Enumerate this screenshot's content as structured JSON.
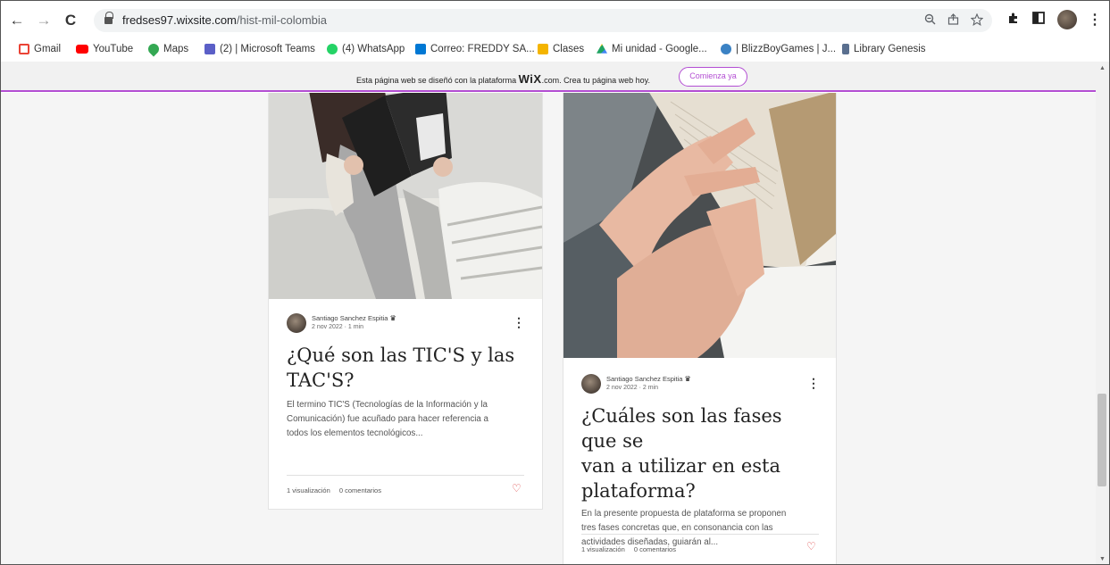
{
  "browser": {
    "nav": {
      "back": "←",
      "forward": "→",
      "reload": "C"
    },
    "url_domain": "fredses97.wixsite.com",
    "url_path": "/hist-mil-colombia",
    "icons": [
      "zoom-icon",
      "share-icon",
      "star-icon",
      "extensions-icon",
      "side-panel-icon",
      "menu-icon"
    ]
  },
  "bookmarks": [
    {
      "label": "Gmail",
      "color": "#ea4335"
    },
    {
      "label": "YouTube",
      "color": "#ff0000"
    },
    {
      "label": "Maps",
      "color": "#34a853"
    },
    {
      "label": "(2) | Microsoft Teams",
      "color": "#5b5fc7"
    },
    {
      "label": "(4) WhatsApp",
      "color": "#25d366"
    },
    {
      "label": "Correo: FREDDY SA...",
      "color": "#0078d4"
    },
    {
      "label": "Clases",
      "color": "#f4b400"
    },
    {
      "label": "Mi unidad - Google...",
      "color": "#1fa463"
    },
    {
      "label": "| BlizzBoyGames | J...",
      "color": "#3b82c4"
    },
    {
      "label": "Library Genesis",
      "color": "#5a6f8f"
    }
  ],
  "wix_banner": {
    "text_before": "Esta página web se diseñó con la plataforma",
    "logo": "WiX",
    "text_after": ".com. Crea tu página web hoy.",
    "button": "Comienza ya"
  },
  "posts": [
    {
      "author": "Santiago Sanchez Espitia",
      "date": "2 nov 2022",
      "read_time": "1 min",
      "title_line1": "¿Qué son las TIC'S y las",
      "title_line2": "TAC'S?",
      "excerpt_line1": "El termino TIC'S (Tecnologías de la Información y la",
      "excerpt_line2": "Comunicación) fue acuñado para hacer referencia a",
      "excerpt_line3": "todos los elementos tecnológicos...",
      "views": "1 visualización",
      "comments": "0 comentarios"
    },
    {
      "author": "Santiago Sanchez Espitia",
      "date": "2 nov 2022",
      "read_time": "2 min",
      "title_line1": "¿Cuáles son las fases que se",
      "title_line2": "van a utilizar en esta",
      "title_line3": "plataforma?",
      "excerpt_line1": "En la presente propuesta de plataforma se proponen",
      "excerpt_line2": "tres fases concretas que, en consonancia con las",
      "excerpt_line3": "actividades diseñadas, guiarán al...",
      "views": "1 visualización",
      "comments": "0 comentarios"
    }
  ]
}
